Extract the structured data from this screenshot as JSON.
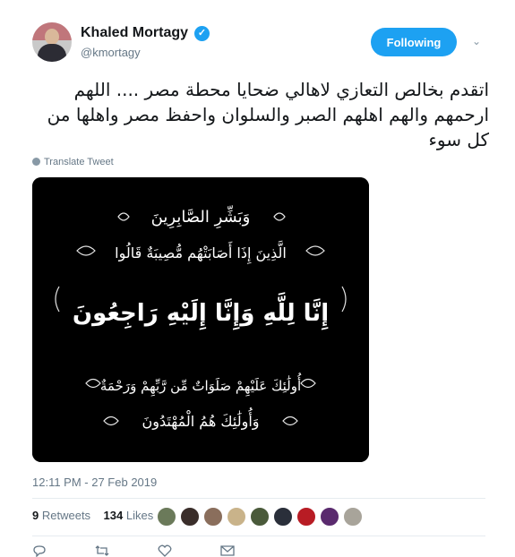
{
  "author": {
    "name": "Khaled Mortagy",
    "handle": "@kmortagy"
  },
  "follow_button": {
    "label": "Following"
  },
  "tweet": {
    "text": "اتقدم بخالص التعازي لاهالي ضحايا محطة مصر .... اللهم ارحمهم والهم اهلهم الصبر والسلوان واحفظ مصر واهلها من كل سوء",
    "translate_label": "Translate Tweet",
    "timestamp": "12:11 PM - 27 Feb 2019"
  },
  "image": {
    "lines": [
      "وَبَشِّرِ الصَّابِرِينَ",
      "الَّذِينَ إِذَا أَصَابَتْهُم مُّصِيبَةٌ قَالُوا",
      "إِنَّا لِلَّهِ وَإِنَّا إِلَيْهِ رَاجِعُونَ",
      "أُولَٰئِكَ عَلَيْهِمْ صَلَوَاتٌ مِّن رَّبِّهِمْ وَرَحْمَةٌ",
      "وَأُولَٰئِكَ هُمُ الْمُهْتَدُونَ"
    ]
  },
  "stats": {
    "retweets_count": "9",
    "retweets_label": "Retweets",
    "likes_count": "134",
    "likes_label": "Likes"
  },
  "likers": [
    {
      "color": "#6b7a5a"
    },
    {
      "color": "#3a2e2a"
    },
    {
      "color": "#8a6e5c"
    },
    {
      "color": "#c9b38a"
    },
    {
      "color": "#4a5a3a"
    },
    {
      "color": "#2a2f3a"
    },
    {
      "color": "#b81c24"
    },
    {
      "color": "#5a2a6e"
    },
    {
      "color": "#a8a49a"
    }
  ],
  "actions": [
    {
      "icon": "reply-icon"
    },
    {
      "icon": "retweet-icon"
    },
    {
      "icon": "like-icon"
    },
    {
      "icon": "message-icon"
    }
  ],
  "colors": {
    "accent": "#1da1f2",
    "muted": "#657786"
  }
}
